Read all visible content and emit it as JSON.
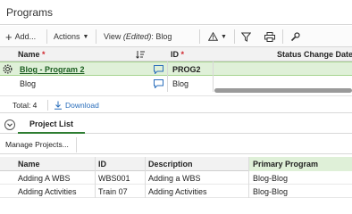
{
  "window": {
    "title": "Programs"
  },
  "toolbar": {
    "add_label": "Add...",
    "actions_label": "Actions",
    "view_prefix": "View ",
    "view_edited": "(Edited)",
    "view_name": ": Blog"
  },
  "grid": {
    "columns": {
      "name": "Name",
      "id": "ID",
      "status": "Status Change Date"
    },
    "required_marker": "*",
    "rows": [
      {
        "name": "Blog - Program 2",
        "id": "PROG2"
      },
      {
        "name": "Blog",
        "id": "Blog"
      }
    ]
  },
  "footer": {
    "total_label": "Total: 4",
    "download_label": "Download"
  },
  "panel": {
    "tab_label": "Project List",
    "manage_button": "Manage Projects...",
    "columns": {
      "name": "Name",
      "id": "ID",
      "description": "Description",
      "primary_program": "Primary Program"
    },
    "rows": [
      {
        "name": "Adding A WBS",
        "id": "WBS001",
        "description": "Adding a WBS",
        "primary_program": "Blog-Blog"
      },
      {
        "name": "Adding Activities",
        "id": "Train 07",
        "description": "Adding Activities",
        "primary_program": "Blog-Blog"
      }
    ]
  },
  "colors": {
    "accent_green": "#2e7d32",
    "row_highlight": "#dff0d8",
    "required": "#d0262d",
    "link_blue": "#2a6ebb"
  }
}
